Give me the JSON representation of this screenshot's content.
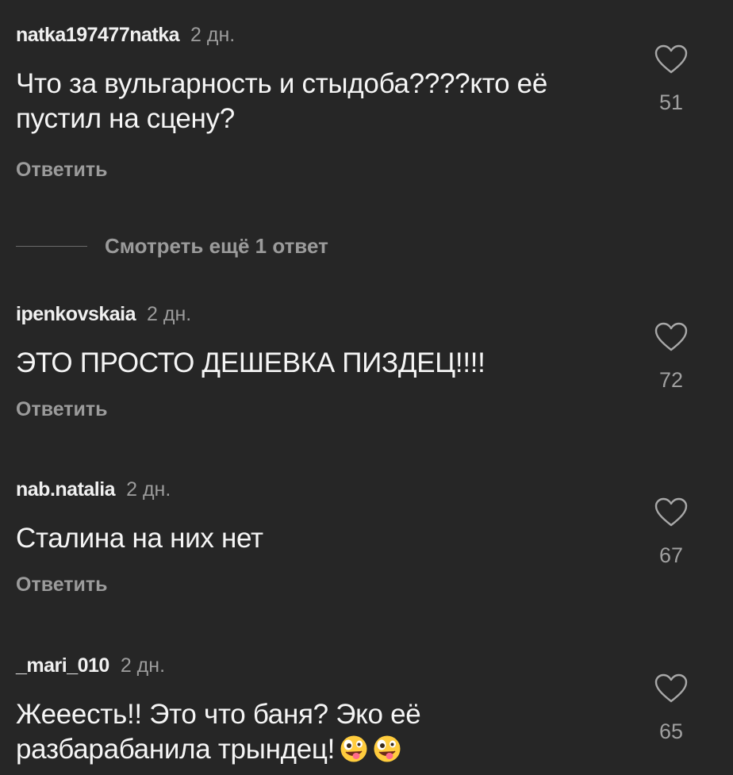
{
  "comments": [
    {
      "username": "natka197477natka",
      "time": "2 дн.",
      "text": "Что за вульгарность и стыдоба????кто её пустил на сцену?",
      "reply_label": "Ответить",
      "likes": "51",
      "icon": "heart-outline-icon"
    },
    {
      "username": "ipenkovskaia",
      "time": "2 дн.",
      "text": "ЭТО ПРОСТО ДЕШЕВКА ПИЗДЕЦ!!!!",
      "reply_label": "Ответить",
      "likes": "72",
      "icon": "heart-outline-icon"
    },
    {
      "username": "nab.natalia",
      "time": "2 дн.",
      "text": "Сталина  на них нет",
      "reply_label": "Ответить",
      "likes": "67",
      "icon": "heart-outline-icon"
    },
    {
      "username": "_mari_010",
      "time": "2 дн.",
      "text": "Жееесть!! Это что баня? Эко её разбарабанила трындец!",
      "emoji": [
        "zany-face-emoji",
        "zany-face-emoji"
      ],
      "likes": "65",
      "icon": "heart-outline-icon"
    }
  ],
  "more_replies": {
    "label": "Смотреть ещё 1 ответ"
  },
  "colors": {
    "background": "#262626",
    "primary_text": "#f5f5f5",
    "secondary_text": "#9b9b9b",
    "emoji_yellow": "#ffcc3d"
  }
}
